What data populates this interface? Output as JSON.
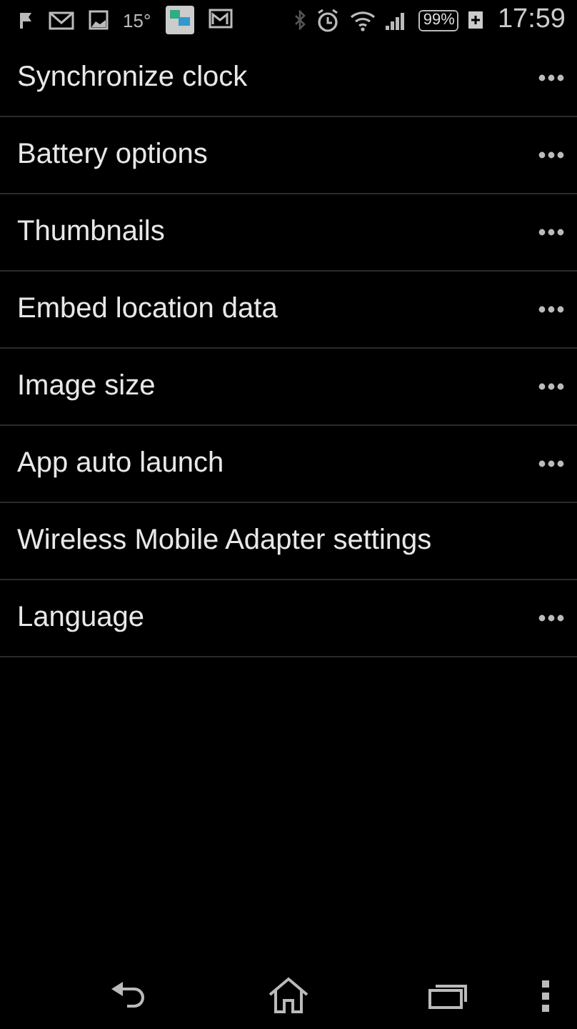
{
  "status_bar": {
    "temperature": "15°",
    "battery": "99%",
    "time": "17:59"
  },
  "menu_items": [
    {
      "label": "Synchronize clock",
      "more": true
    },
    {
      "label": "Battery options",
      "more": true
    },
    {
      "label": "Thumbnails",
      "more": true
    },
    {
      "label": "Embed location data",
      "more": true
    },
    {
      "label": "Image size",
      "more": true
    },
    {
      "label": "App auto launch",
      "more": true
    },
    {
      "label": "Wireless Mobile Adapter settings",
      "more": false
    },
    {
      "label": "Language",
      "more": true
    }
  ]
}
